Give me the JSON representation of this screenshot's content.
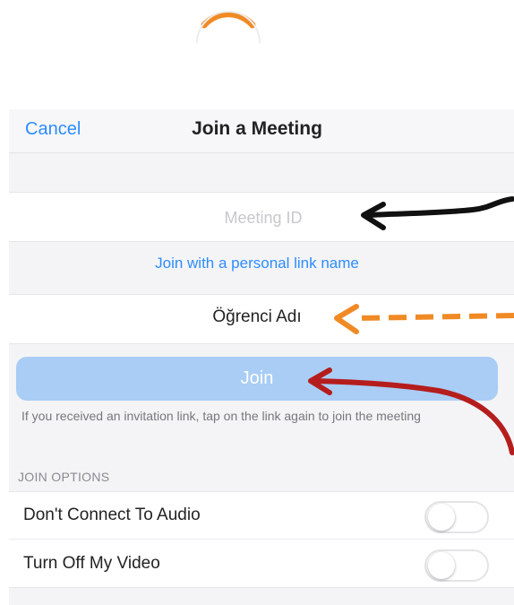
{
  "nav": {
    "cancel_label": "Cancel",
    "title": "Join a Meeting"
  },
  "meeting": {
    "placeholder": "Meeting ID",
    "value": ""
  },
  "personal_link_label": "Join with a personal link name",
  "name_field": {
    "value": "Öğrenci Adı"
  },
  "join_button_label": "Join",
  "hint_text": "If you received an invitation link, tap on the link again to join the meeting",
  "join_options": {
    "header": "JOIN OPTIONS",
    "items": [
      {
        "label": "Don't Connect To Audio",
        "on": false
      },
      {
        "label": "Turn Off My Video",
        "on": false
      }
    ]
  },
  "colors": {
    "accent": "#2d8cff",
    "join_button": "#a9cdf5",
    "arrow_black": "#111111",
    "arrow_orange": "#f08a24",
    "arrow_red": "#b51d1d",
    "logo_orange": "#f08a24"
  },
  "icons": [
    "logo-arc-icon",
    "arrow-meeting-id-icon",
    "arrow-student-name-icon",
    "arrow-join-icon"
  ]
}
